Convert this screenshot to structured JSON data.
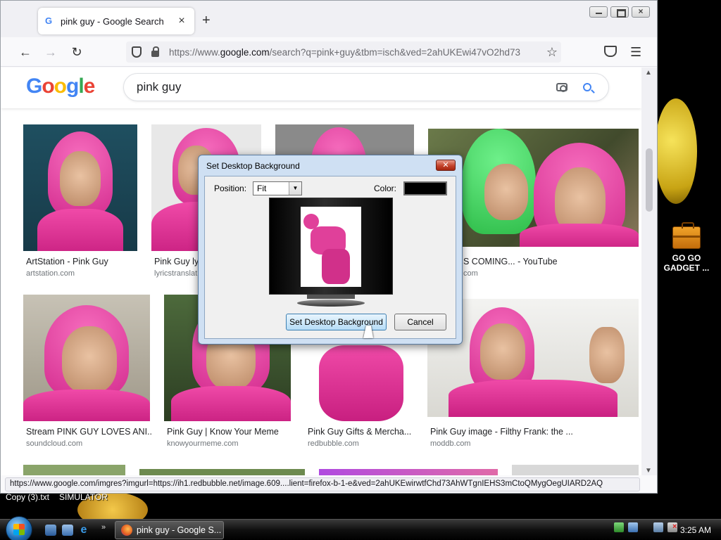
{
  "browser": {
    "tab_title": "pink guy - Google Search",
    "new_tab_symbol": "+",
    "url_prefix": "https://www.",
    "url_host": "google.com",
    "url_path": "/search?q=pink+guy&tbm=isch&ved=2ahUKEwi47vO2hd73",
    "status_text": "https://www.google.com/imgres?imgurl=https://ih1.redbubble.net/image.609....lient=firefox-b-1-e&ved=2ahUKEwirwtfChd73AhWTgnIEHS3mCtoQMygOegUIARD2AQ"
  },
  "google": {
    "logo_letters": [
      "G",
      "o",
      "o",
      "g",
      "l",
      "e"
    ],
    "logo_colors": [
      "#4285f4",
      "#ea4335",
      "#fbbc05",
      "#4285f4",
      "#34a853",
      "#ea4335"
    ],
    "search_value": "pink guy"
  },
  "results": [
    {
      "title": "ArtStation - Pink Guy",
      "source": "artstation.com"
    },
    {
      "title": "Pink Guy lyr",
      "source": "lyricstranslat"
    },
    {
      "title": "S COMING... - YouTube",
      "source": "com"
    },
    {
      "title": "Stream PINK GUY LOVES ANI...",
      "source": "soundcloud.com"
    },
    {
      "title": "Pink Guy | Know Your Meme",
      "source": "knowyourmeme.com"
    },
    {
      "title": "Pink Guy Gifts & Mercha...",
      "source": "redbubble.com"
    },
    {
      "title": "Pink Guy image - Filthy Frank: the ...",
      "source": "moddb.com"
    }
  ],
  "dialog": {
    "title": "Set Desktop Background",
    "close_symbol": "✕",
    "position_label": "Position:",
    "position_value": "Fit",
    "color_label": "Color:",
    "color_value": "#000000",
    "set_button": "Set Desktop Background",
    "cancel_button": "Cancel"
  },
  "desktop": {
    "gadget_label": "GO GO GADGET ...",
    "file1": "Copy (3).txt",
    "file2": "SIMULATOR"
  },
  "taskbar": {
    "task_label": "pink guy - Google S...",
    "clock": "3:25 AM",
    "more_symbol": "»"
  }
}
